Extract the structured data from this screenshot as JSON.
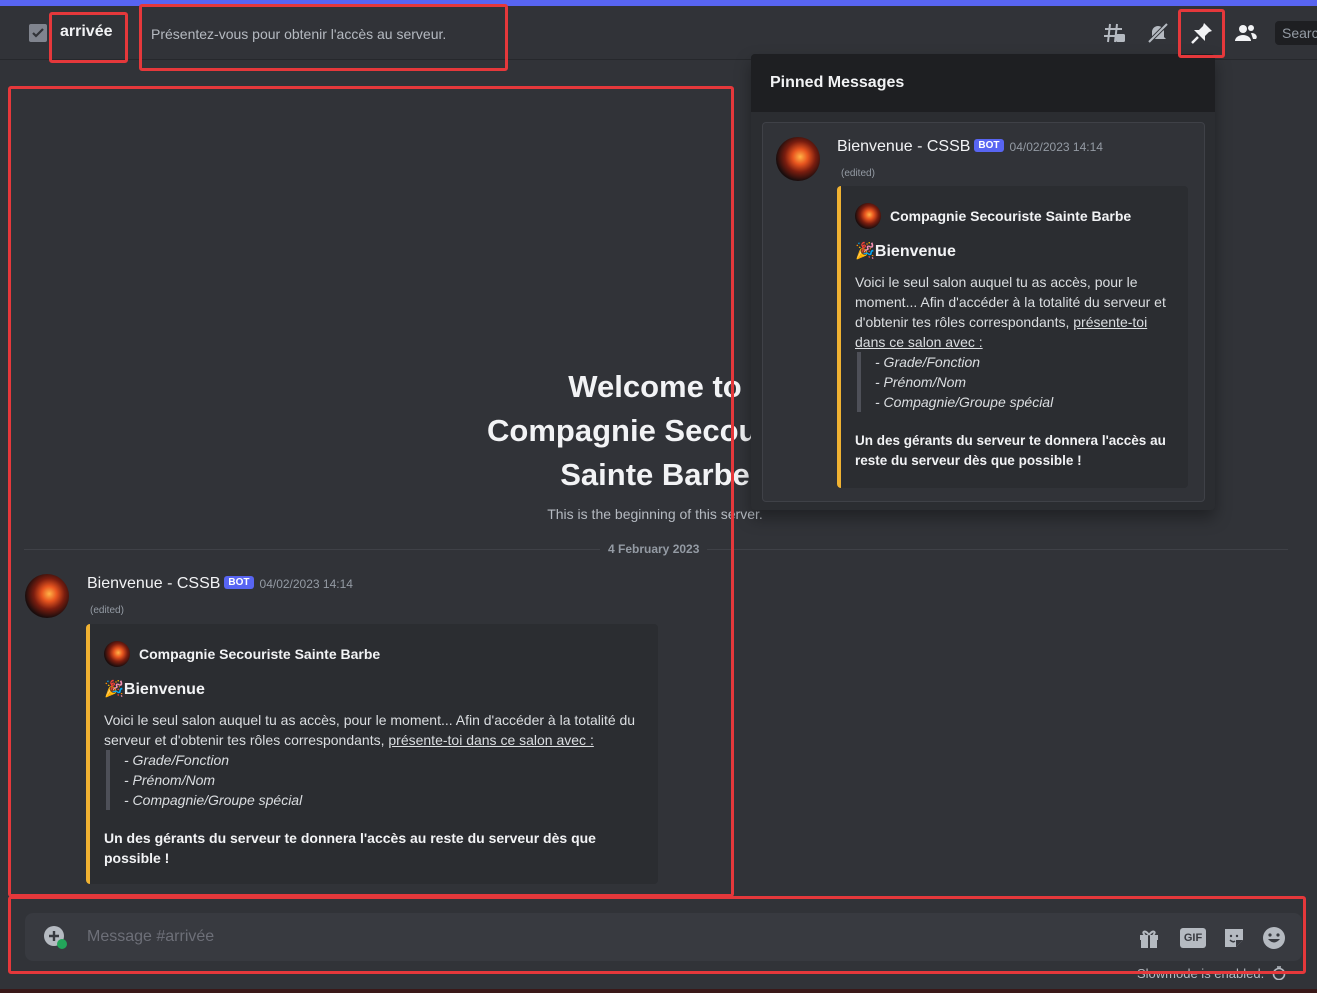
{
  "header": {
    "channel_name": "arrivée",
    "topic": "Présentez-vous pour obtenir l'accès au serveur.",
    "search_placeholder": "Search"
  },
  "welcome": {
    "title_line1": "Welcome to",
    "title_line2": "Compagnie Secouriste",
    "title_line3": "Sainte Barbe",
    "subtitle": "This is the beginning of this server."
  },
  "divider_date": "4 February 2023",
  "message": {
    "author": "Bienvenue - CSSB",
    "bot_tag": "BOT",
    "timestamp": "04/02/2023 14:14",
    "edited": "(edited)",
    "embed": {
      "author": "Compagnie Secouriste Sainte Barbe",
      "title_emoji": "🎉",
      "title": "Bienvenue",
      "desc_plain": "Voici le seul salon auquel tu as accès, pour le moment... Afin d'accéder à la totalité du serveur et d'obtenir tes rôles correspondants, ",
      "desc_underlined": "présente-toi dans ce salon avec :",
      "items": [
        "- Grade/Fonction",
        "- Prénom/Nom",
        "- Compagnie/Groupe spécial"
      ],
      "footer_bold": "Un des gérants du serveur te donnera l'accès au reste du serveur dès que possible !"
    }
  },
  "pinned": {
    "heading": "Pinned Messages"
  },
  "composer": {
    "placeholder": "Message #arrivée",
    "gif_label": "GIF"
  },
  "slowmode": "Slowmode is enabled."
}
